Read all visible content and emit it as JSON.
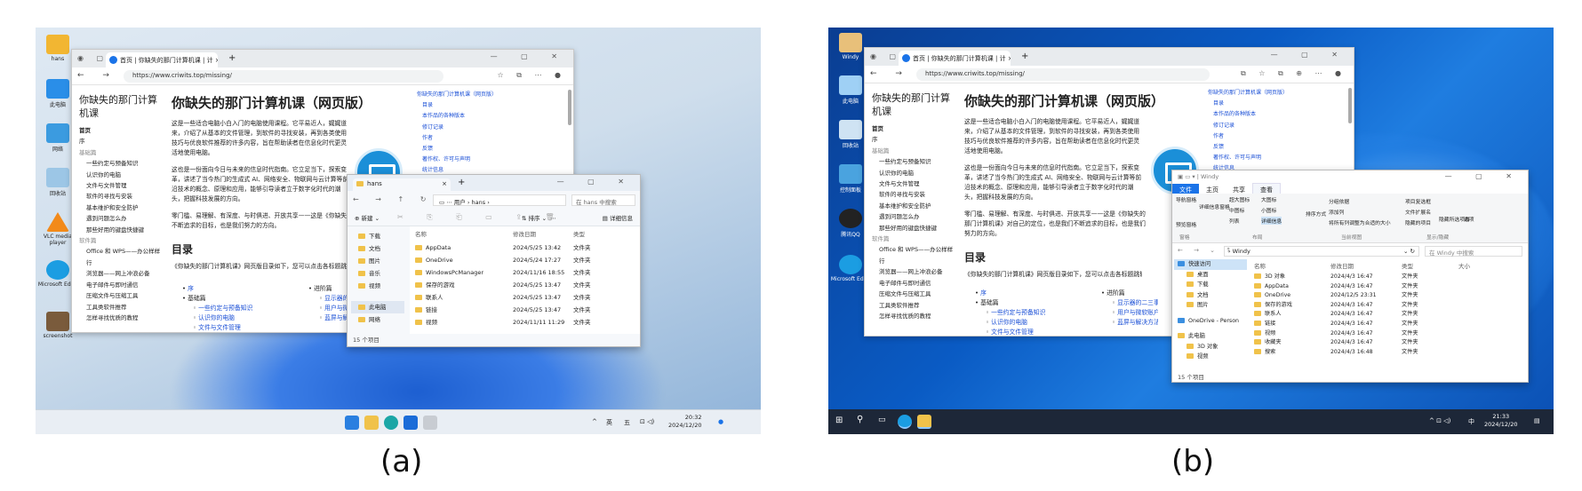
{
  "captions": {
    "a": "(a)",
    "b": "(b)"
  },
  "colors": {
    "win11_accent": "#1a73e8",
    "win10_desktop": "#0a5bc4",
    "link": "#1a4fd6"
  },
  "panel_a": {
    "desktop_icons": [
      {
        "label": "hans",
        "icon": "user-folder-icon"
      },
      {
        "label": "此电脑",
        "icon": "computer-icon"
      },
      {
        "label": "网络",
        "icon": "network-icon"
      },
      {
        "label": "回收站",
        "icon": "recycle-bin-icon"
      },
      {
        "label": "VLC media player",
        "icon": "vlc-icon"
      },
      {
        "label": "Microsoft Edge",
        "icon": "edge-icon"
      },
      {
        "label": "screenshot",
        "icon": "image-file-icon"
      }
    ],
    "browser": {
      "tab_title": "首页 | 你缺失的那门计算机课 | 计",
      "url": "https://www.criwits.top/missing/",
      "sidebar_title": "你缺失的那门计算机课",
      "sidebar_items": [
        {
          "text": "首页",
          "kind": "bold"
        },
        {
          "text": "序",
          "kind": "item"
        },
        {
          "text": "基础篇",
          "kind": "sec"
        },
        {
          "text": "一些约定与预备知识",
          "kind": "sub"
        },
        {
          "text": "认识你的电脑",
          "kind": "sub"
        },
        {
          "text": "文件与文件管理",
          "kind": "sub"
        },
        {
          "text": "软件的寻找与安装",
          "kind": "sub"
        },
        {
          "text": "基本维护和安全防护",
          "kind": "sub"
        },
        {
          "text": "遇到问题怎么办",
          "kind": "sub"
        },
        {
          "text": "那些好用的键盘快捷键",
          "kind": "sub"
        },
        {
          "text": "软件篇",
          "kind": "sec"
        },
        {
          "text": "Office 和 WPS——办公样样行",
          "kind": "sub"
        },
        {
          "text": "浏览器——网上冲浪必备",
          "kind": "sub"
        },
        {
          "text": "电子邮件与即时通信",
          "kind": "sub"
        },
        {
          "text": "压缩文件与压缩工具",
          "kind": "sub"
        },
        {
          "text": "工具类软件推荐",
          "kind": "sub"
        },
        {
          "text": "怎样寻找优质的教程",
          "kind": "sub"
        }
      ],
      "heading": "你缺失的那门计算机课（网页版）",
      "paragraphs": [
        "这是一些适合电脑小白入门的电脑使用课程。它平易近人，娓娓道来，介绍了从基本的文件管理，到软件的寻找安装，再到各类使用技巧与优良软件推荐的许多内容，旨在帮助读者在信息化时代更灵活地使用电脑。",
        "这也是一份面向今日与未来的信息时代指南。它立足当下，探索变革，讲述了当今热门的生成式 AI、网络安全、物联网与云计算等前沿技术的概念、原理和应用，能够引导读者立于数字化时代的潮头，把握科技发展的方向。",
        "零门槛、易理解、有深度、与时俱进、开放共享——这是《你缺失的那门计算机课》对自己的定位，也是我们不断追求的目标，也是我们努力的方向。"
      ],
      "toc_heading": "目录",
      "toc_intro": "《你缺失的那门计算机课》网页版目录如下，您可以点击各标题跳转到对应页面。",
      "toc_left": [
        {
          "text": "序",
          "level": 1
        },
        {
          "text": "基础篇",
          "level": 1
        },
        {
          "text": "一些约定与预备知识",
          "level": 2
        },
        {
          "text": "认识你的电脑",
          "level": 2
        },
        {
          "text": "文件与文件管理",
          "level": 2
        }
      ],
      "toc_right": [
        {
          "text": "进阶篇",
          "level": 1
        },
        {
          "text": "显示器的二三事",
          "level": 2
        },
        {
          "text": "用户与微软账户",
          "level": 2
        },
        {
          "text": "蓝屏与解决方法",
          "level": 2
        }
      ],
      "page_toc": [
        "你缺失的那门计算机课（网页版）",
        "目录",
        "本作品的各种版本",
        "修订记录",
        "作者",
        "反馈",
        "著作权、许可与声明",
        "统计信息"
      ]
    },
    "explorer": {
      "title": "hans",
      "breadcrumb": "用户  ›  hans  ›",
      "search_placeholder": "在 hans 中搜索",
      "new_label": "新建",
      "sort_label": "排序",
      "view_label": "查看",
      "details_label": "详细信息",
      "nav": [
        "下载",
        "文档",
        "图片",
        "音乐",
        "视频",
        "此电脑",
        "网络"
      ],
      "columns": [
        "名称",
        "修改日期",
        "类型"
      ],
      "rows": [
        {
          "name": "AppData",
          "date": "2024/5/25 13:42",
          "type": "文件夹"
        },
        {
          "name": "OneDrive",
          "date": "2024/5/24 17:27",
          "type": "文件夹"
        },
        {
          "name": "WindowsPcManager",
          "date": "2024/11/16 18:55",
          "type": "文件夹"
        },
        {
          "name": "保存的游戏",
          "date": "2024/5/25 13:47",
          "type": "文件夹"
        },
        {
          "name": "联系人",
          "date": "2024/5/25 13:47",
          "type": "文件夹"
        },
        {
          "name": "链接",
          "date": "2024/5/25 13:47",
          "type": "文件夹"
        },
        {
          "name": "视频",
          "date": "2024/11/11 11:29",
          "type": "文件夹"
        }
      ],
      "status": "15 个项目"
    },
    "taskbar": {
      "ime": "英",
      "ime2": "五",
      "time": "20:32",
      "date": "2024/12/20"
    }
  },
  "panel_b": {
    "desktop_icons": [
      {
        "label": "Windy",
        "icon": "user-icon"
      },
      {
        "label": "此电脑",
        "icon": "computer-icon"
      },
      {
        "label": "回收站",
        "icon": "recycle-bin-icon"
      },
      {
        "label": "控制面板",
        "icon": "control-panel-icon"
      },
      {
        "label": "腾讯QQ",
        "icon": "qq-icon"
      },
      {
        "label": "Microsoft Edge",
        "icon": "edge-icon"
      }
    ],
    "explorer": {
      "title": "Windy",
      "ribbon_tabs": [
        "文件",
        "主页",
        "共享",
        "查看"
      ],
      "ribbon_groups": [
        "窗格",
        "布局",
        "当前视图",
        "显示/隐藏"
      ],
      "ribbon_items": [
        "导航窗格",
        "预览窗格",
        "详细信息窗格",
        "超大图标",
        "大图标",
        "中图标",
        "小图标",
        "列表",
        "详细信息",
        "排序方式",
        "分组依据",
        "添加列",
        "将所有列调整为合适的大小",
        "项目复选框",
        "文件扩展名",
        "隐藏的项目",
        "隐藏所选项目",
        "选项"
      ],
      "path": "Windy",
      "search_placeholder": "在 Windy 中搜索",
      "nav": [
        "快速访问",
        "桌面",
        "下载",
        "文档",
        "图片",
        "OneDrive - Person",
        "此电脑",
        "3D 对象",
        "视频"
      ],
      "columns": [
        "名称",
        "修改日期",
        "类型",
        "大小"
      ],
      "rows": [
        {
          "name": "3D 对象",
          "date": "2024/4/3 16:47",
          "type": "文件夹"
        },
        {
          "name": "AppData",
          "date": "2024/4/3 16:47",
          "type": "文件夹"
        },
        {
          "name": "OneDrive",
          "date": "2024/12/5 23:31",
          "type": "文件夹"
        },
        {
          "name": "保存的游戏",
          "date": "2024/4/3 16:47",
          "type": "文件夹"
        },
        {
          "name": "联系人",
          "date": "2024/4/3 16:47",
          "type": "文件夹"
        },
        {
          "name": "链接",
          "date": "2024/4/3 16:47",
          "type": "文件夹"
        },
        {
          "name": "视频",
          "date": "2024/4/3 16:47",
          "type": "文件夹"
        },
        {
          "name": "收藏夹",
          "date": "2024/4/3 16:47",
          "type": "文件夹"
        },
        {
          "name": "搜索",
          "date": "2024/4/3 16:48",
          "type": "文件夹"
        }
      ],
      "status": "15 个项目"
    },
    "taskbar": {
      "ime": "中",
      "time": "21:33",
      "date": "2024/12/20"
    }
  }
}
